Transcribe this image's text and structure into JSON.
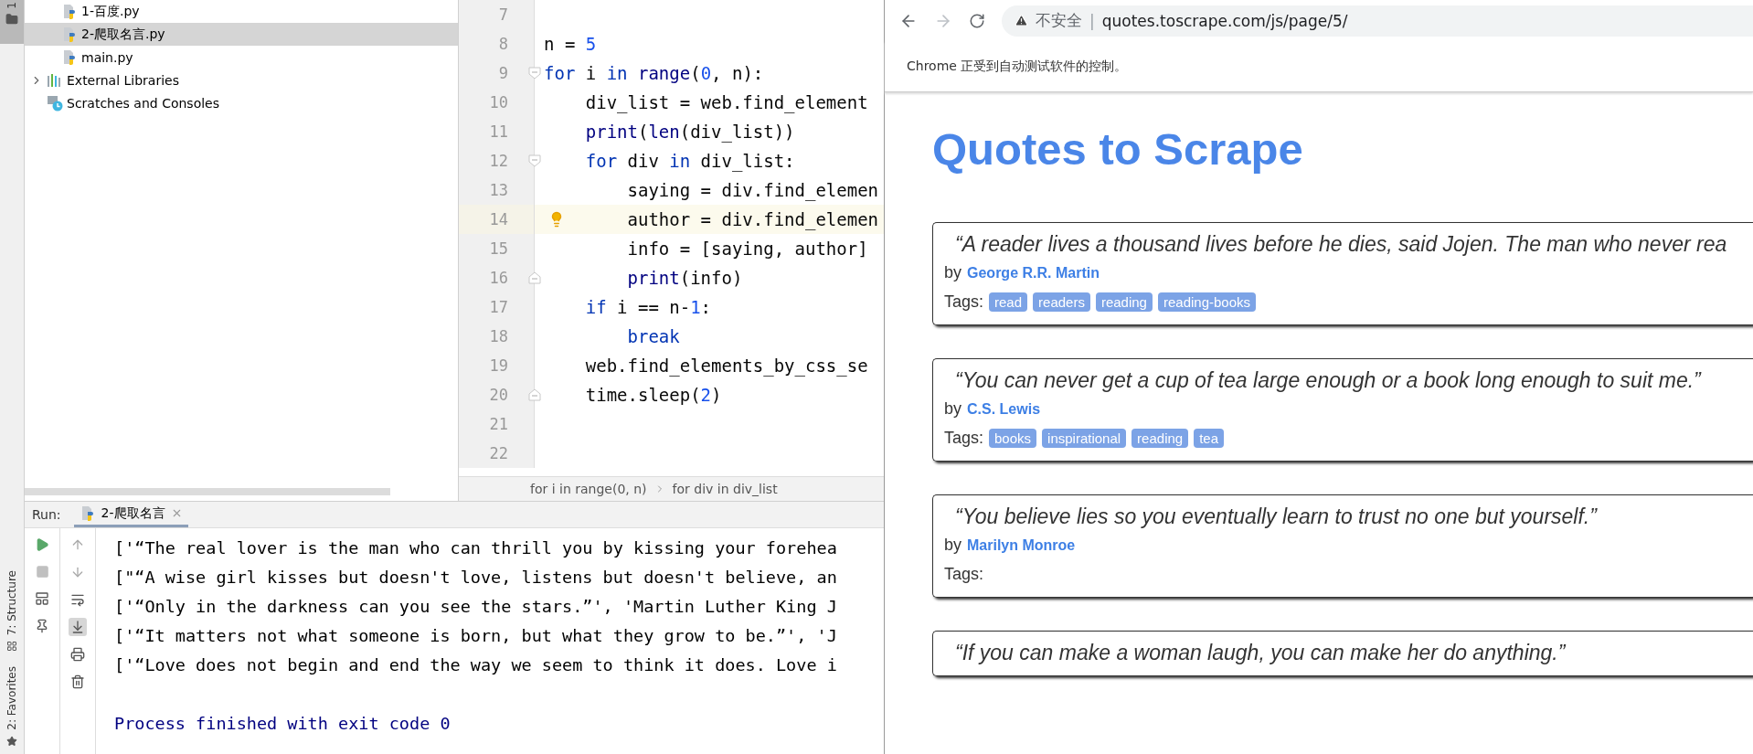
{
  "tool_strip": {
    "top_tab": "1",
    "bottom_tabs": [
      {
        "label": "7: Structure",
        "kind": "structure"
      },
      {
        "label": "2: Favorites",
        "kind": "favorites"
      }
    ]
  },
  "project": {
    "items": [
      {
        "label": "1-百度.py",
        "kind": "python-file",
        "selected": false
      },
      {
        "label": "2-爬取名言.py",
        "kind": "python-file",
        "selected": true
      },
      {
        "label": "main.py",
        "kind": "python-file",
        "selected": false
      },
      {
        "label": "External Libraries",
        "kind": "libraries",
        "selected": false,
        "expanded": false
      },
      {
        "label": "Scratches and Consoles",
        "kind": "scratches",
        "selected": false
      }
    ]
  },
  "editor": {
    "lines": [
      {
        "number": "7"
      },
      {
        "number": "8",
        "segments": [
          {
            "kind": "plain",
            "text": "n = "
          },
          {
            "kind": "number",
            "text": "5"
          }
        ]
      },
      {
        "number": "9",
        "fold_open": true,
        "segments": [
          {
            "kind": "keyword",
            "text": "for"
          },
          {
            "kind": "plain",
            "text": " i "
          },
          {
            "kind": "keyword",
            "text": "in"
          },
          {
            "kind": "builtin",
            "text": " range"
          },
          {
            "kind": "plain",
            "text": "("
          },
          {
            "kind": "number",
            "text": "0"
          },
          {
            "kind": "plain",
            "text": ", n):"
          }
        ]
      },
      {
        "number": "10",
        "segments": [
          {
            "kind": "plain",
            "text": "    div_list = web.find_element"
          }
        ]
      },
      {
        "number": "11",
        "segments": [
          {
            "kind": "builtin",
            "text": "    print"
          },
          {
            "kind": "plain",
            "text": "("
          },
          {
            "kind": "builtin",
            "text": "len"
          },
          {
            "kind": "plain",
            "text": "(div_list))"
          }
        ]
      },
      {
        "number": "12",
        "fold_open": true,
        "segments": [
          {
            "kind": "keyword",
            "text": "    for"
          },
          {
            "kind": "plain",
            "text": " div "
          },
          {
            "kind": "keyword",
            "text": "in"
          },
          {
            "kind": "plain",
            "text": " div_list:"
          }
        ]
      },
      {
        "number": "13",
        "segments": [
          {
            "kind": "plain",
            "text": "        saying = div.find_elemen"
          }
        ]
      },
      {
        "number": "14",
        "current": true,
        "bulb": true,
        "segments": [
          {
            "kind": "plain",
            "text": "        author = div.find_elemen"
          }
        ]
      },
      {
        "number": "15",
        "segments": [
          {
            "kind": "plain",
            "text": "        info = [saying, author]"
          }
        ]
      },
      {
        "number": "16",
        "fold_close": true,
        "segments": [
          {
            "kind": "builtin",
            "text": "        print"
          },
          {
            "kind": "plain",
            "text": "(info)"
          }
        ]
      },
      {
        "number": "17",
        "segments": [
          {
            "kind": "keyword",
            "text": "    if"
          },
          {
            "kind": "plain",
            "text": " i == n-"
          },
          {
            "kind": "number",
            "text": "1"
          },
          {
            "kind": "plain",
            "text": ":"
          }
        ]
      },
      {
        "number": "18",
        "segments": [
          {
            "kind": "keyword",
            "text": "        break"
          }
        ]
      },
      {
        "number": "19",
        "segments": [
          {
            "kind": "plain",
            "text": "    web.find_elements_by_css_se"
          }
        ]
      },
      {
        "number": "20",
        "fold_close": true,
        "segments": [
          {
            "kind": "plain",
            "text": "    time.sleep("
          },
          {
            "kind": "number",
            "text": "2"
          },
          {
            "kind": "plain",
            "text": ")"
          }
        ]
      },
      {
        "number": "21"
      },
      {
        "number": "22"
      }
    ],
    "breadcrumbs": [
      "for i in range(0, n)",
      "for div in div_list"
    ]
  },
  "run": {
    "label": "Run:",
    "tab": "2-爬取名言",
    "scroll_to_end": true,
    "output": [
      {
        "kind": "data",
        "text": "['“The real lover is the man who can thrill you by kissing your forehea"
      },
      {
        "kind": "data",
        "text": "[\"“A wise girl kisses but doesn't love, listens but doesn't believe, an"
      },
      {
        "kind": "data",
        "text": "['“Only in the darkness can you see the stars.”', 'Martin Luther King J"
      },
      {
        "kind": "data",
        "text": "['“It matters not what someone is born, but what they grow to be.”', 'J"
      },
      {
        "kind": "data",
        "text": "['“Love does not begin and end the way we seem to think it does. Love i"
      },
      {
        "kind": "blank"
      },
      {
        "kind": "status",
        "text": "Process finished with exit code 0"
      }
    ]
  },
  "browser": {
    "forward_disabled": true,
    "security": "不安全",
    "separator": "|",
    "url": "quotes.toscrape.com/js/page/5/",
    "infobar": "Chrome 正受到自动测试软件的控制。",
    "page_title": "Quotes to Scrape",
    "quotes": [
      {
        "text": "“A reader lives a thousand lives before he dies, said Jojen. The man who never rea",
        "by": "by",
        "author": "George R.R. Martin",
        "tags_label": "Tags:",
        "tags": [
          "read",
          "readers",
          "reading",
          "reading-books"
        ]
      },
      {
        "text": "“You can never get a cup of tea large enough or a book long enough to suit me.”",
        "by": "by",
        "author": "C.S. Lewis",
        "tags_label": "Tags:",
        "tags": [
          "books",
          "inspirational",
          "reading",
          "tea"
        ]
      },
      {
        "text": "“You believe lies so you eventually learn to trust no one but yourself.”",
        "by": "by",
        "author": "Marilyn Monroe",
        "tags_label": "Tags:"
      },
      {
        "text": "“If you can make a woman laugh, you can make her do anything.”"
      }
    ]
  }
}
